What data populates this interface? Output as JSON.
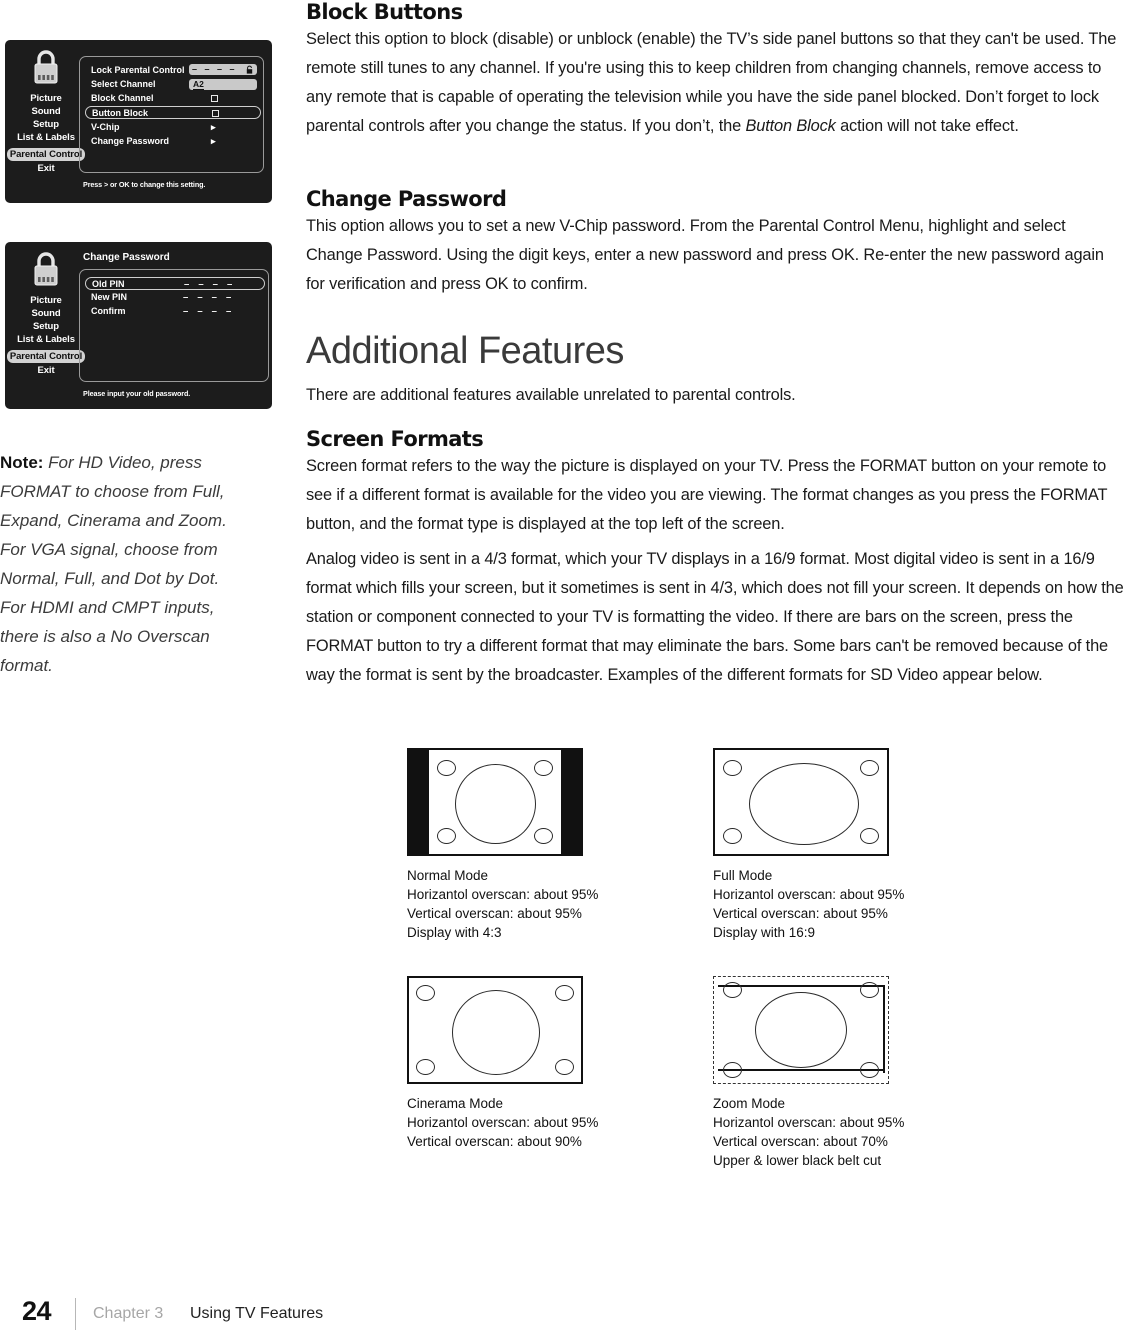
{
  "page": {
    "number": "24",
    "chapter": "Chapter 3",
    "title": "Using TV Features"
  },
  "sections": {
    "block_buttons": {
      "heading": "Block Buttons",
      "body": "Select this option to block (disable) or unblock (enable) the TV’s side panel buttons so that they can't be used. The remote still tunes to any channel. If you're using this to keep children from changing channels, remove access to any remote that is capable of operating the television while you have the side panel blocked. Don’t forget to lock parental controls after you change the status. If you don’t, the ",
      "body_italic": "Button Block",
      "body_tail": " action will not take effect."
    },
    "change_password": {
      "heading": "Change Password",
      "body": "This option allows you to set a new V-Chip password. From the Parental Control Menu, highlight and select Change Password. Using the digit keys, enter a new password and press OK. Re-enter the new password again for verification and press OK to confirm."
    },
    "additional_features": {
      "heading": "Additional Features",
      "body": "There are additional features available unrelated to parental controls."
    },
    "screen_formats": {
      "heading": "Screen Formats",
      "body_1": "Screen format refers to the way the picture is displayed on your TV. Press the FORMAT button on your remote to see if a different format is available for the video you are viewing. The format changes as you press the FORMAT button, and the format type is displayed at the top left of the screen.",
      "body_2": "Analog video is sent in a 4/3 format, which your TV displays in a 16/9 format. Most digital video is sent in a 16/9 format which fills your screen, but it sometimes is sent in 4/3, which does not fill your screen. It depends on how the station or component connected to your TV is formatting the video. If there are bars on the screen, press the FORMAT button to try a different format that may eliminate the bars. Some bars can't be removed because of the way the format is sent by the broadcaster. Examples of the different formats for SD Video appear below."
    }
  },
  "side_note": {
    "label": "Note:",
    "text": " For HD Video, press FORMAT to choose from Full, Expand, Cinerama and Zoom. For VGA signal, choose from Normal, Full, and Dot by Dot. For HDMI and CMPT inputs, there is also a No Overscan format."
  },
  "osd_menus": [
    {
      "name": "parental-control-menu",
      "title": "",
      "icon": "padlock-icon",
      "nav": [
        {
          "label": "Picture",
          "selected": false
        },
        {
          "label": "Sound",
          "selected": false
        },
        {
          "label": "Setup",
          "selected": false
        },
        {
          "label": "List & Labels",
          "selected": false
        },
        {
          "label": "Parental Control",
          "selected": true
        },
        {
          "label": "Exit",
          "selected": false
        }
      ],
      "rows": [
        {
          "label": "Lock Parental Control",
          "value": "– – – –",
          "type": "pin",
          "highlight": false
        },
        {
          "label": "Select Channel",
          "value": "A2",
          "type": "channel",
          "highlight": false
        },
        {
          "label": "Block Channel",
          "value": "",
          "type": "checkbox",
          "highlight": false
        },
        {
          "label": "Button Block",
          "value": "",
          "type": "checkbox",
          "highlight": true
        },
        {
          "label": "V-Chip",
          "value": "▸",
          "type": "arrow",
          "highlight": false
        },
        {
          "label": "Change Password",
          "value": "▸",
          "type": "arrow",
          "highlight": false
        }
      ],
      "hint": "Press > or OK to change this setting."
    },
    {
      "name": "change-password-menu",
      "title": "Change Password",
      "icon": "padlock-icon",
      "nav": [
        {
          "label": "Picture",
          "selected": false
        },
        {
          "label": "Sound",
          "selected": false
        },
        {
          "label": "Setup",
          "selected": false
        },
        {
          "label": "List & Labels",
          "selected": false
        },
        {
          "label": "Parental Control",
          "selected": true
        },
        {
          "label": "Exit",
          "selected": false
        }
      ],
      "rows": [
        {
          "label": "Old PIN",
          "value": "– – – –",
          "type": "dashes",
          "highlight": true
        },
        {
          "label": "New PIN",
          "value": "– – – –",
          "type": "dashes",
          "highlight": false
        },
        {
          "label": "Confirm",
          "value": "– – – –",
          "type": "dashes",
          "highlight": false
        }
      ],
      "hint": "Please input your old password."
    }
  ],
  "format_examples": [
    {
      "id": "normal-mode",
      "name": "Normal Mode",
      "lines": [
        "Normal Mode",
        "Horizantol overscan: about 95%",
        "Vertical overscan: about 95%",
        "Display with 4:3"
      ]
    },
    {
      "id": "full-mode",
      "name": "Full Mode",
      "lines": [
        "Full Mode",
        "Horizantol overscan: about 95%",
        "Vertical overscan: about 95%",
        "Display with 16:9"
      ]
    },
    {
      "id": "cinerama-mode",
      "name": "Cinerama Mode",
      "lines": [
        "Cinerama Mode",
        "Horizantol overscan: about 95%",
        "Vertical overscan: about 90%"
      ]
    },
    {
      "id": "zoom-mode",
      "name": "Zoom Mode",
      "lines": [
        "Zoom Mode",
        "Horizantol overscan: about 95%",
        "Vertical overscan: about 70%",
        "Upper & lower black belt cut"
      ]
    }
  ],
  "colors": {
    "osd_background": "#1c1c1c",
    "osd_highlight": "#d2d2d2",
    "chapter_gray": "#a6a6a6",
    "heading_gray": "#3a3a3a"
  }
}
